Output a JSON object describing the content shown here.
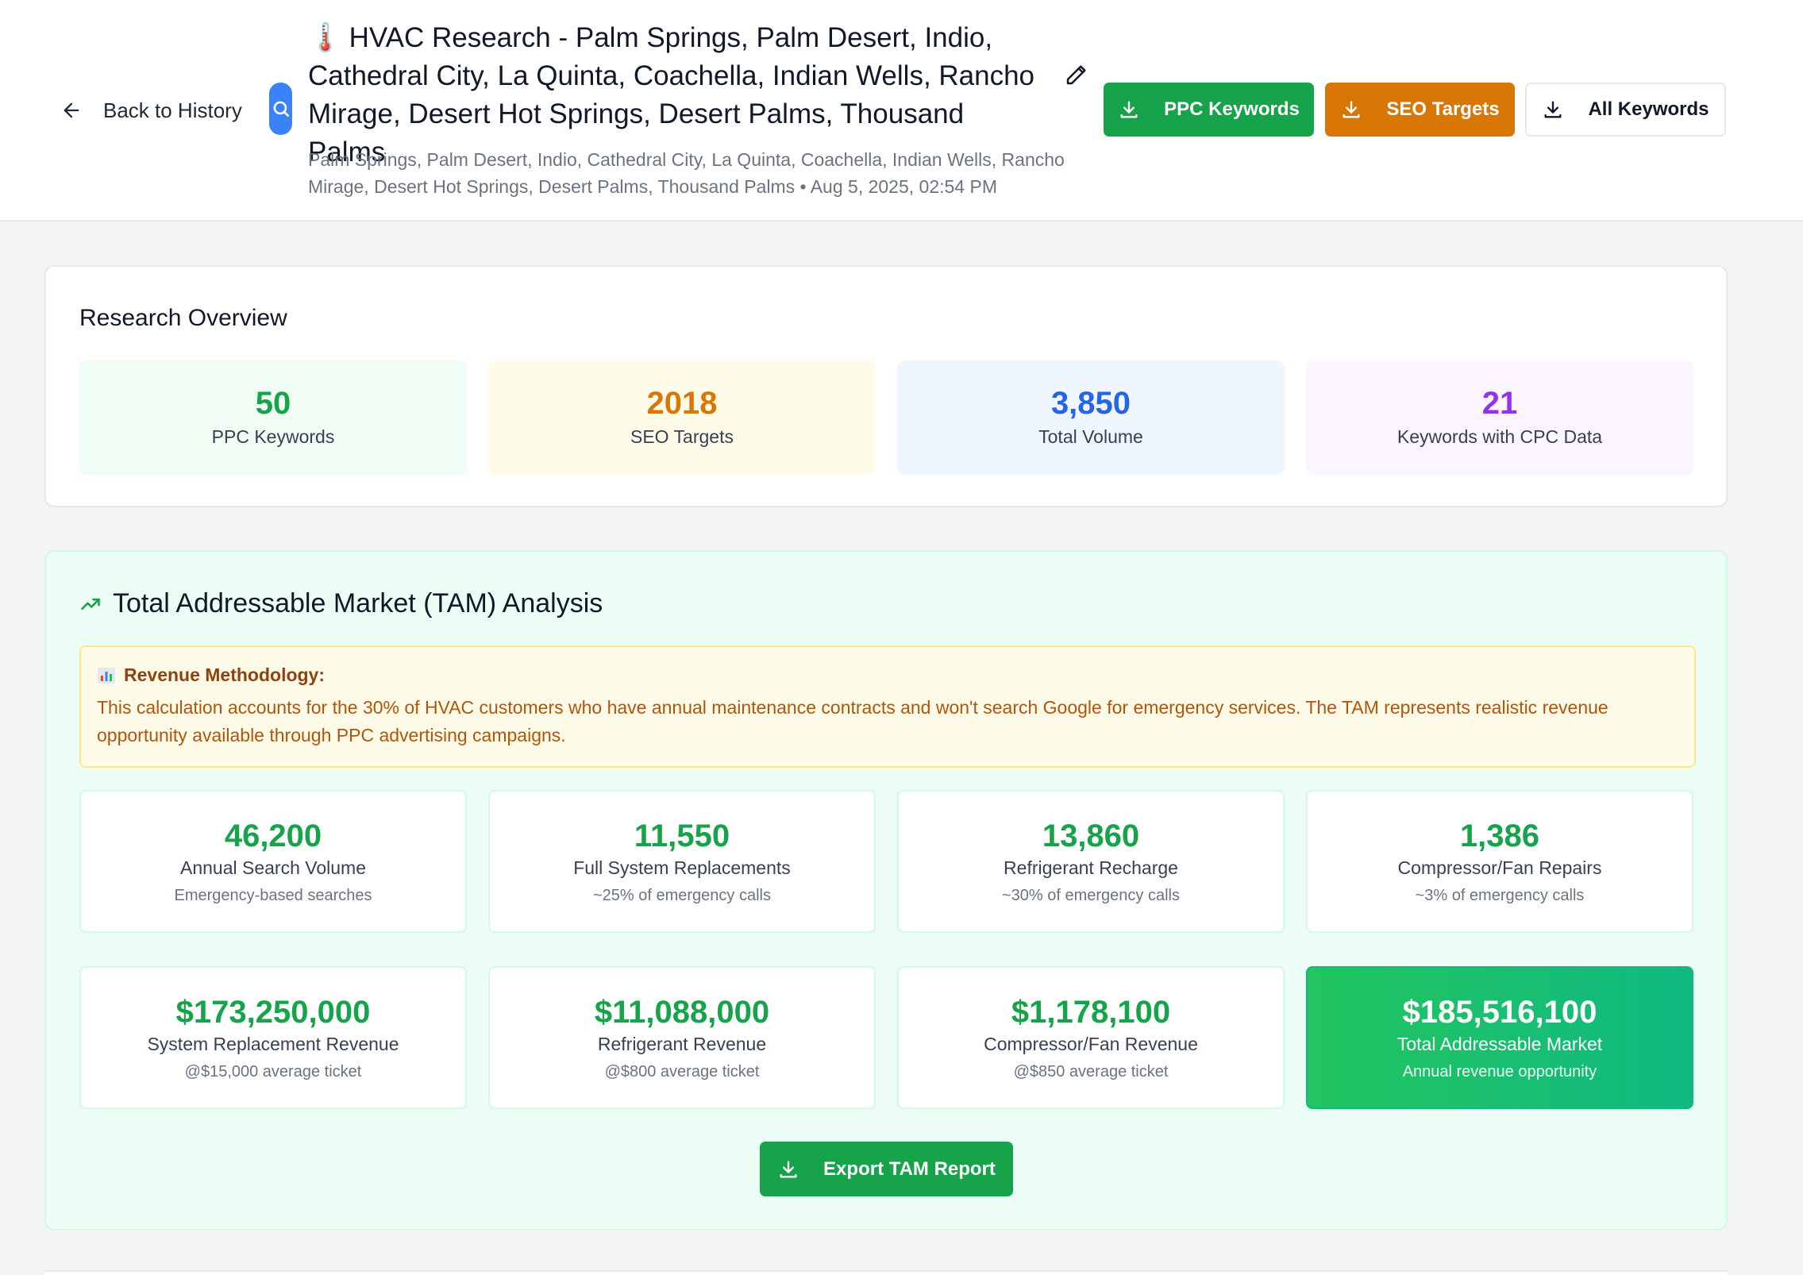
{
  "header": {
    "back_label": "Back to History",
    "title_emoji": "🌡️",
    "title": "HVAC Research - Palm Springs, Palm Desert, Indio, Cathedral City, La Quinta, Coachella, Indian Wells, Rancho Mirage, Desert Hot Springs, Desert Palms, Thousand Palms",
    "subtitle": "Palm Springs, Palm Desert, Indio, Cathedral City, La Quinta, Coachella, Indian Wells, Rancho Mirage, Desert Hot Springs, Desert Palms, Thousand Palms • Aug 5, 2025, 02:54 PM",
    "buttons": {
      "ppc": "PPC Keywords",
      "seo": "SEO Targets",
      "all": "All Keywords"
    }
  },
  "overview": {
    "title": "Research Overview",
    "stats": [
      {
        "value": "50",
        "label": "PPC Keywords"
      },
      {
        "value": "2018",
        "label": "SEO Targets"
      },
      {
        "value": "3,850",
        "label": "Total Volume"
      },
      {
        "value": "21",
        "label": "Keywords with CPC Data"
      }
    ]
  },
  "tam": {
    "title": "Total Addressable Market (TAM) Analysis",
    "methodology": {
      "heading": "Revenue Methodology:",
      "text": "This calculation accounts for the 30% of HVAC customers who have annual maintenance contracts and won't search Google for emergency services. The TAM represents realistic revenue opportunity available through PPC advertising campaigns."
    },
    "metrics": [
      {
        "value": "46,200",
        "label": "Annual Search Volume",
        "sub": "Emergency-based searches"
      },
      {
        "value": "11,550",
        "label": "Full System Replacements",
        "sub": "~25% of emergency calls"
      },
      {
        "value": "13,860",
        "label": "Refrigerant Recharge",
        "sub": "~30% of emergency calls"
      },
      {
        "value": "1,386",
        "label": "Compressor/Fan Repairs",
        "sub": "~3% of emergency calls"
      }
    ],
    "revenue": [
      {
        "value": "$173,250,000",
        "label": "System Replacement Revenue",
        "sub": "@$15,000 average ticket"
      },
      {
        "value": "$11,088,000",
        "label": "Refrigerant Revenue",
        "sub": "@$800 average ticket"
      },
      {
        "value": "$1,178,100",
        "label": "Compressor/Fan Revenue",
        "sub": "@$850 average ticket"
      },
      {
        "value": "$185,516,100",
        "label": "Total Addressable Market",
        "sub": "Annual revenue opportunity"
      }
    ],
    "export_label": "Export TAM Report"
  },
  "colors": {
    "ppc_green": "#16a34a",
    "seo_orange": "#d97706",
    "volume_blue": "#2563eb",
    "cpc_purple": "#9333ea",
    "search_blue": "#3b82f6"
  }
}
